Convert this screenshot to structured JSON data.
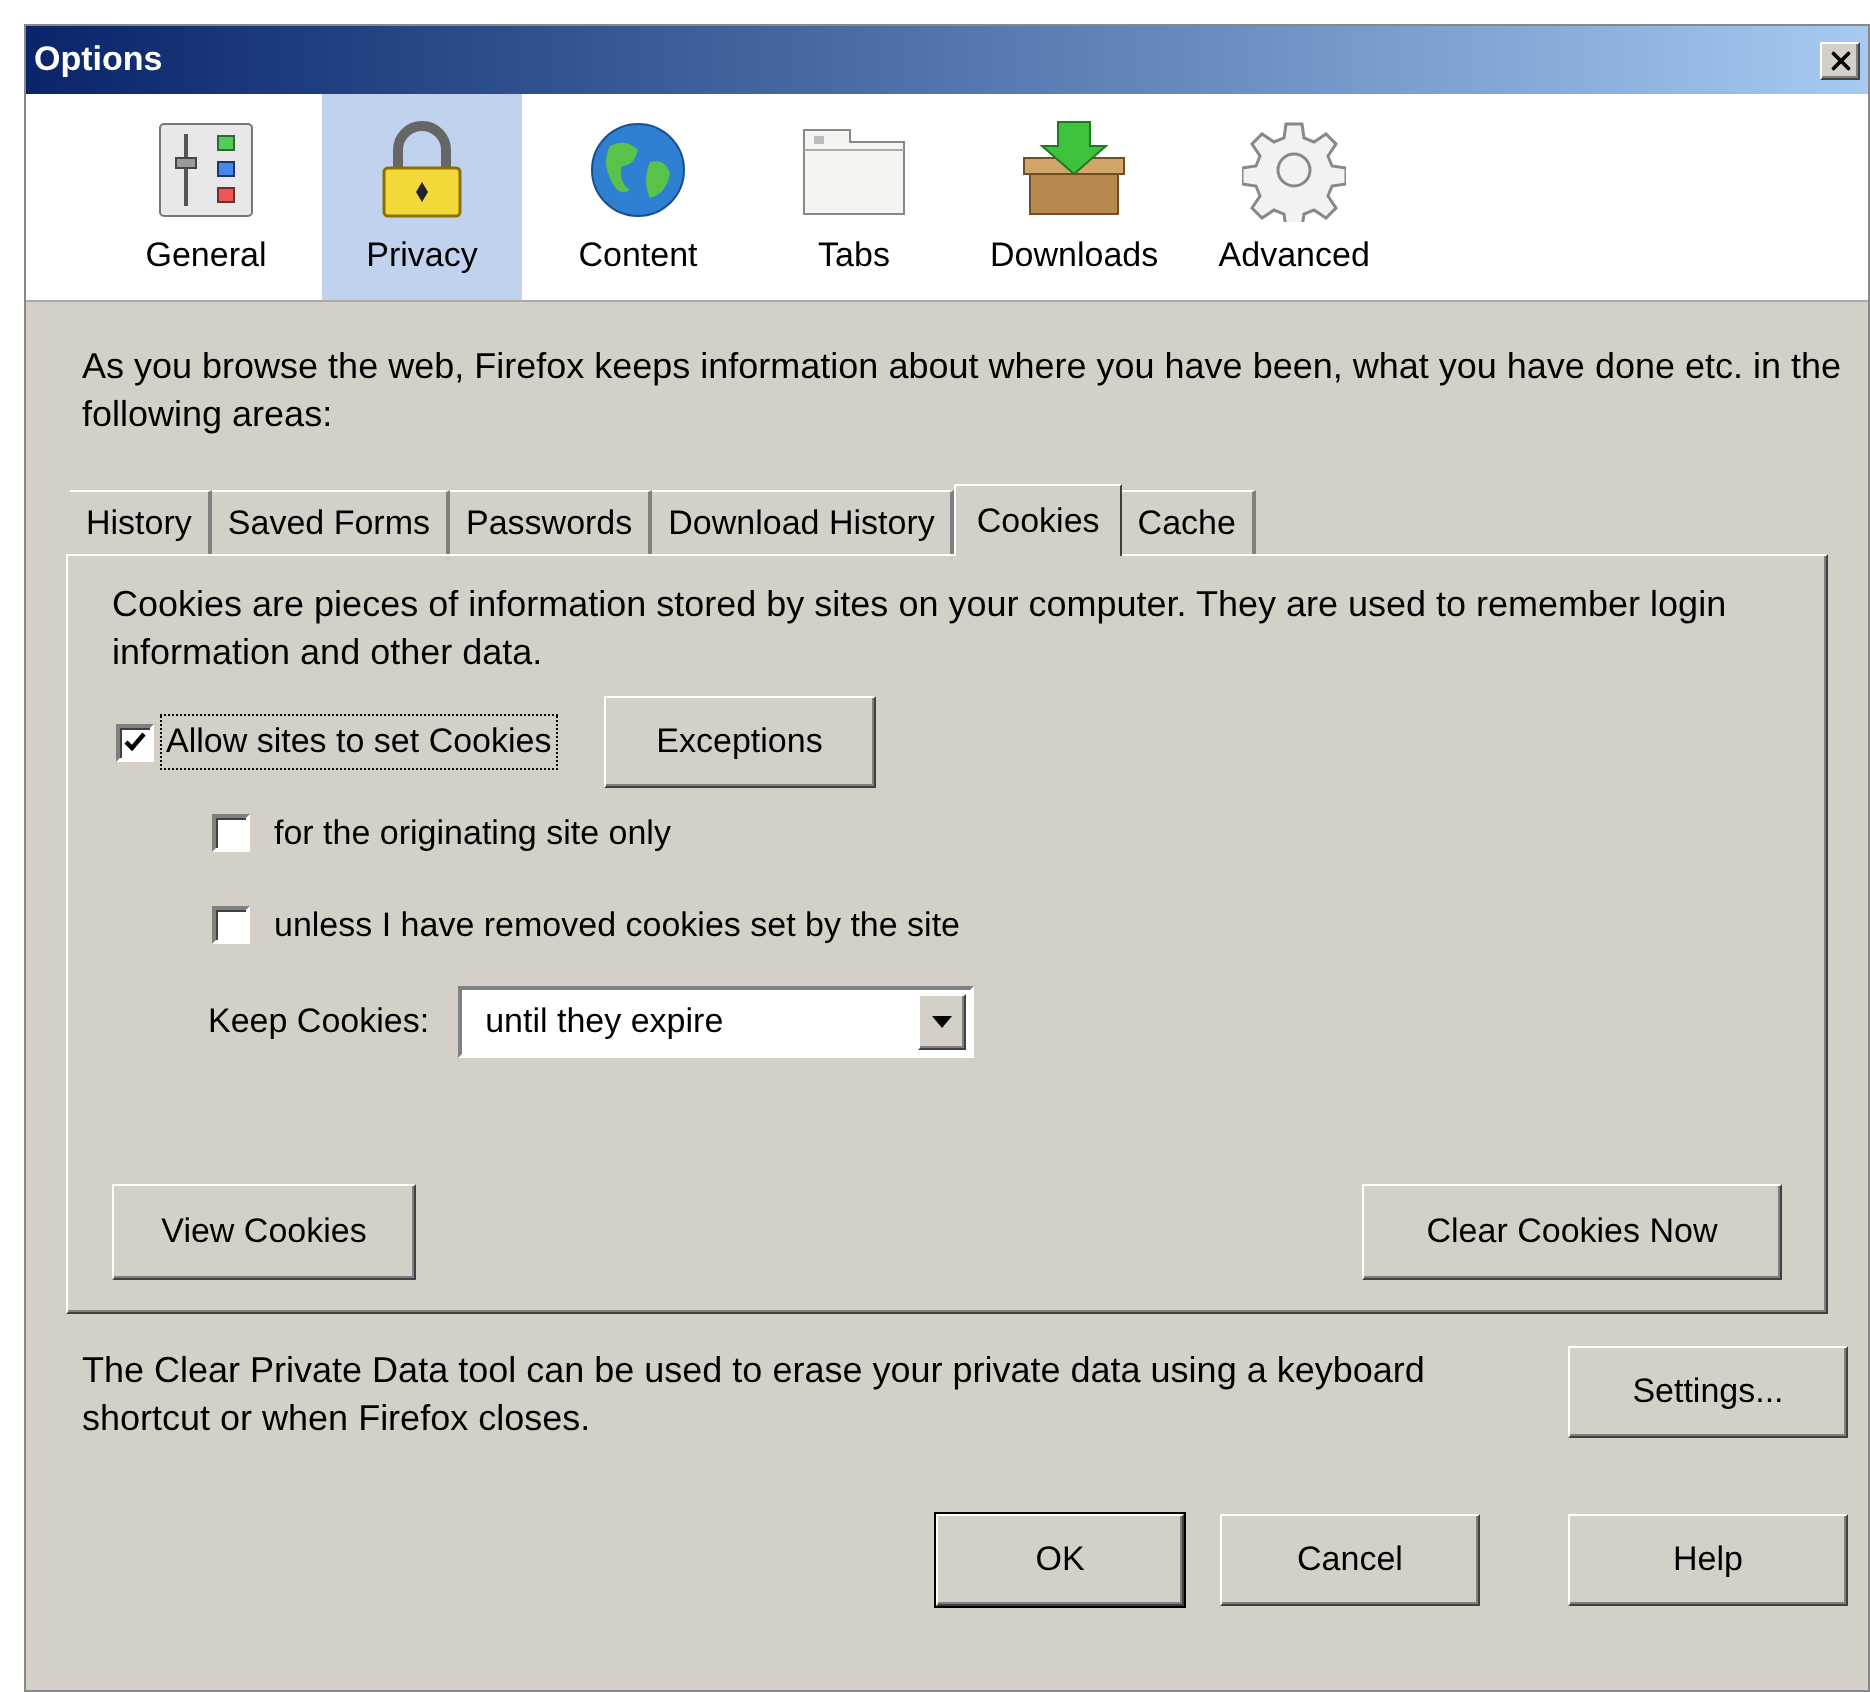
{
  "window": {
    "title": "Options"
  },
  "toolbar": [
    {
      "label": "General",
      "kind": "general",
      "selected": false
    },
    {
      "label": "Privacy",
      "kind": "privacy",
      "selected": true
    },
    {
      "label": "Content",
      "kind": "content",
      "selected": false
    },
    {
      "label": "Tabs",
      "kind": "tabs",
      "selected": false
    },
    {
      "label": "Downloads",
      "kind": "downloads",
      "selected": false
    },
    {
      "label": "Advanced",
      "kind": "advanced",
      "selected": false
    }
  ],
  "intro": "As you browse the web, Firefox keeps information about where you have been, what you have done etc. in the following areas:",
  "tabs": [
    {
      "label": "History",
      "selected": false
    },
    {
      "label": "Saved Forms",
      "selected": false
    },
    {
      "label": "Passwords",
      "selected": false
    },
    {
      "label": "Download History",
      "selected": false
    },
    {
      "label": "Cookies",
      "selected": true
    },
    {
      "label": "Cache",
      "selected": false
    }
  ],
  "cookies": {
    "description": "Cookies are pieces of information stored by sites on your computer. They are used to remember login information and other data.",
    "allow": {
      "label": "Allow sites to set Cookies",
      "checked": true,
      "focused": true
    },
    "exceptions_button": {
      "label": "Exceptions"
    },
    "options": [
      {
        "label": "for the originating site only",
        "checked": false
      },
      {
        "label": "unless I have removed cookies set by the site",
        "checked": false
      }
    ],
    "keep": {
      "label": "Keep Cookies:",
      "value": "until they expire"
    },
    "view_button": {
      "label": "View Cookies"
    },
    "clear_button": {
      "label": "Clear Cookies Now"
    }
  },
  "private_data": {
    "text": "The Clear Private Data tool can be used to erase your private data using a keyboard shortcut or when Firefox closes.",
    "settings_button": {
      "label": "Settings..."
    }
  },
  "buttons": [
    {
      "label": "OK",
      "default": true
    },
    {
      "label": "Cancel",
      "default": false
    },
    {
      "label": "Help",
      "default": false
    }
  ]
}
